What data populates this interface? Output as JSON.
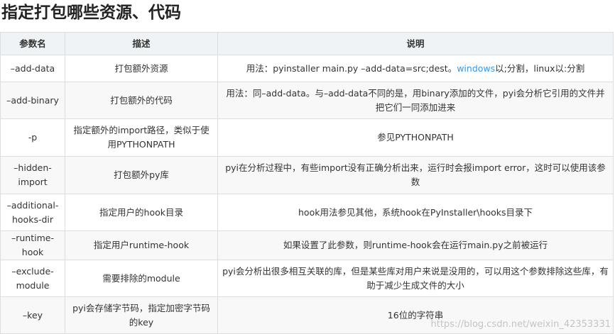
{
  "title": "指定打包哪些资源、代码",
  "table": {
    "headers": [
      "参数名",
      "描述",
      "说明"
    ],
    "rows": [
      {
        "param": "–add-data",
        "desc": "打包额外资源",
        "note_before": "用法：pyinstaller main.py –add-data=src;dest。",
        "note_link": "windows",
        "note_after": "以;分割，linux以:分割"
      },
      {
        "param": "–add-binary",
        "desc": "打包额外的代码",
        "note": "用法：同–add-data。与–add-data不同的是，用binary添加的文件，pyi会分析它引用的文件并把它们一同添加进来"
      },
      {
        "param": "-p",
        "desc": "指定额外的import路径，类似于使用PYTHONPATH",
        "note": "参见PYTHONPATH"
      },
      {
        "param": "–hidden-import",
        "desc": "打包额外py库",
        "note": "pyi在分析过程中，有些import没有正确分析出来，运行时会报import error，这时可以使用该参数"
      },
      {
        "param": "–additional-hooks-dir",
        "desc": "指定用户的hook目录",
        "note": "hook用法参见其他，系统hook在PyInstaller\\hooks目录下"
      },
      {
        "param": "–runtime-hook",
        "desc": "指定用户runtime-hook",
        "note": "如果设置了此参数，则runtime-hook会在运行main.py之前被运行"
      },
      {
        "param": "–exclude-module",
        "desc": "需要排除的module",
        "note": "pyi会分析出很多相互关联的库，但是某些库对用户来说是没用的，可以用这个参数排除这些库，有助于减少生成文件的大小"
      },
      {
        "param": "–key",
        "desc": "pyi会存储字节码，指定加密字节码的key",
        "note": "16位的字符串"
      }
    ]
  },
  "watermark": "https://blog.csdn.net/weixin_42353331"
}
